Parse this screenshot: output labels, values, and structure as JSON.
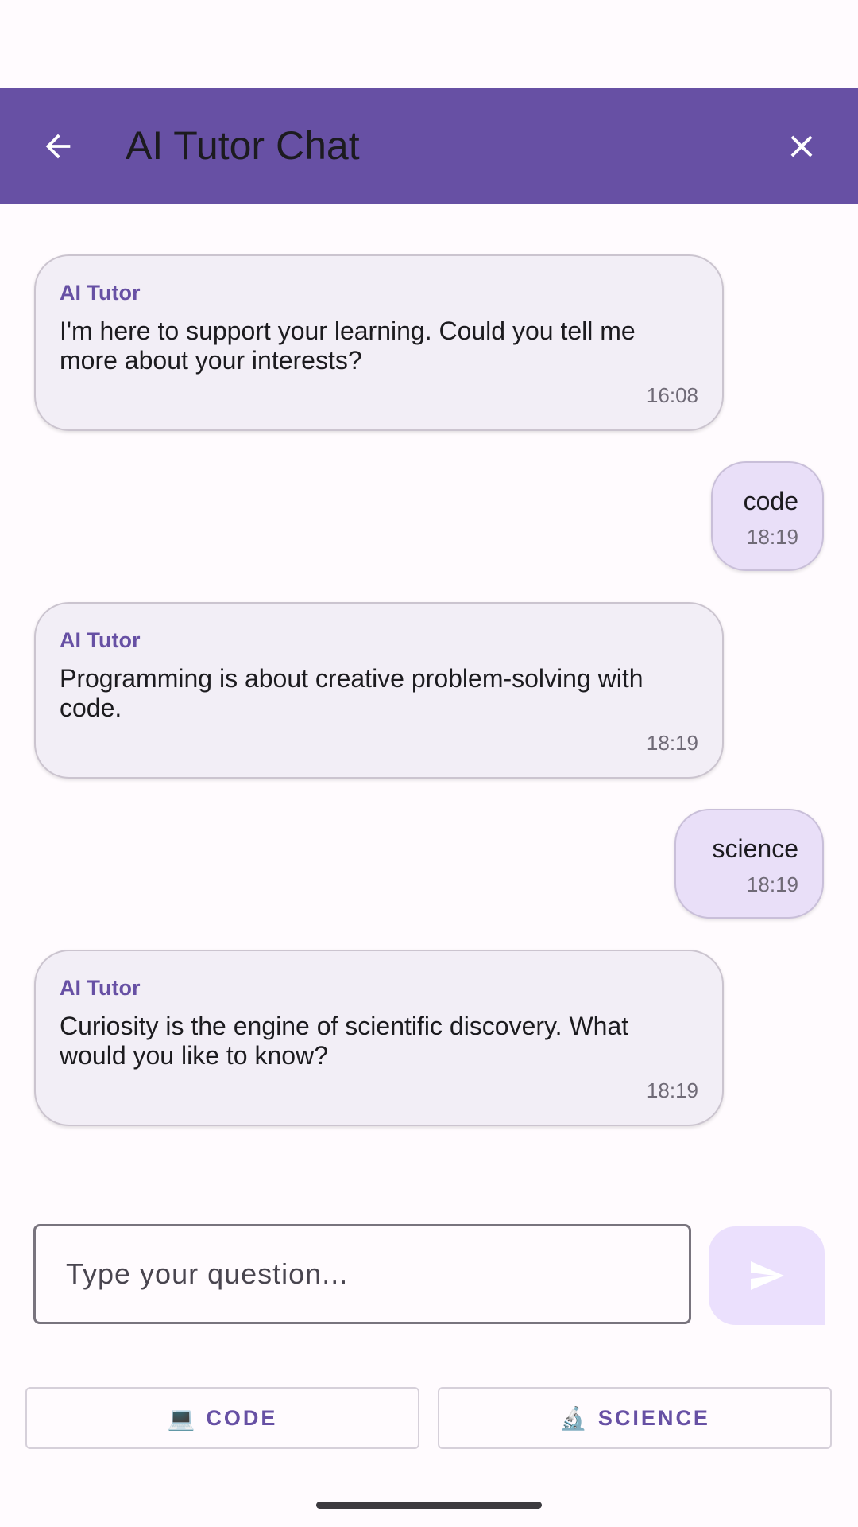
{
  "app_bar": {
    "title": "AI Tutor Chat",
    "back_icon": "arrow-left-icon",
    "close_icon": "close-icon",
    "color": "#6750a4"
  },
  "messages": [
    {
      "role": "ai",
      "sender": "AI Tutor",
      "text": "I'm here to support your learning. Could you tell me more about your interests?",
      "time": "16:08"
    },
    {
      "role": "user",
      "text": "code",
      "time": "18:19"
    },
    {
      "role": "ai",
      "sender": "AI Tutor",
      "text": "Programming is about creative problem-solving with code.",
      "time": "18:19"
    },
    {
      "role": "user",
      "text": "science",
      "time": "18:19"
    },
    {
      "role": "ai",
      "sender": "AI Tutor",
      "text": "Curiosity is the engine of scientific discovery. What would you like to know?",
      "time": "18:19"
    }
  ],
  "input": {
    "placeholder": "Type your question...",
    "value": "",
    "send_icon": "send-icon"
  },
  "quick_actions": [
    {
      "emoji": "💻",
      "label": "CODE"
    },
    {
      "emoji": "🔬",
      "label": "SCIENCE"
    }
  ]
}
